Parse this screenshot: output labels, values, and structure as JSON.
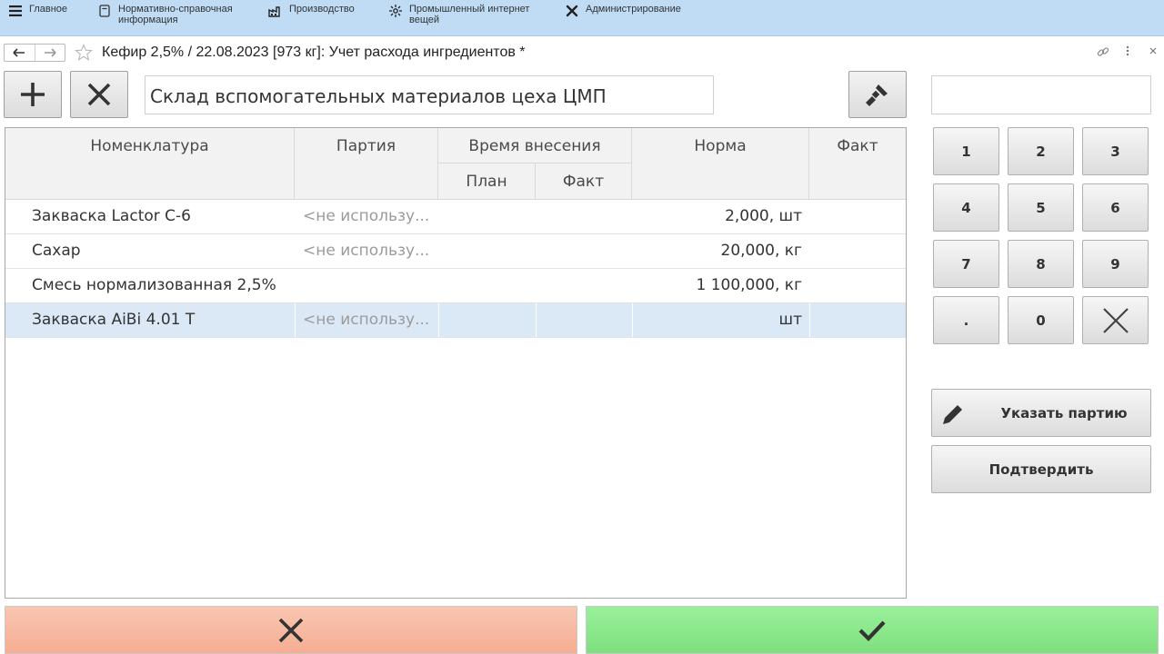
{
  "menu": {
    "items": [
      {
        "label": "Главное",
        "icon": "hamburger-icon"
      },
      {
        "label": "Нормативно-справочная информация",
        "icon": "document-icon"
      },
      {
        "label": "Производство",
        "icon": "factory-icon"
      },
      {
        "label": "Промышленный интернет вещей",
        "icon": "iot-icon"
      },
      {
        "label": "Администрирование",
        "icon": "tools-icon"
      }
    ]
  },
  "window": {
    "title": "Кефир 2,5% / 22.08.2023 [973 кг]: Учет расхода ингредиентов *"
  },
  "toolbar": {
    "warehouse_value": "Склад вспомогательных материалов цеха ЦМП",
    "search_value": ""
  },
  "table": {
    "headers": {
      "name": "Номенклатура",
      "party": "Партия",
      "time": "Время внесения",
      "plan": "План",
      "fact_time": "Факт",
      "norma": "Норма",
      "fact": "Факт"
    },
    "rows": [
      {
        "name": "Закваска Lactor C-6",
        "party": "<не использу...",
        "norma": "2,000, шт",
        "selected": false
      },
      {
        "name": "Сахар",
        "party": "<не использу...",
        "norma": "20,000, кг",
        "selected": false
      },
      {
        "name": "Смесь нормализованная 2,5%",
        "party": "",
        "norma": "1 100,000, кг",
        "selected": false
      },
      {
        "name": "Закваска AiBi 4.01 T",
        "party": "<не использу...",
        "norma": "шт",
        "selected": true
      }
    ]
  },
  "keypad": {
    "keys": [
      "1",
      "2",
      "3",
      "4",
      "5",
      "6",
      "7",
      "8",
      "9",
      ".",
      "0"
    ]
  },
  "actions": {
    "set_party": "Указать партию",
    "confirm": "Подтвердить"
  },
  "colors": {
    "topbar": "#bfdcf4",
    "cancel": "#f9b9a0",
    "ok": "#8fe98f",
    "selected_row": "#dbe9f7"
  }
}
